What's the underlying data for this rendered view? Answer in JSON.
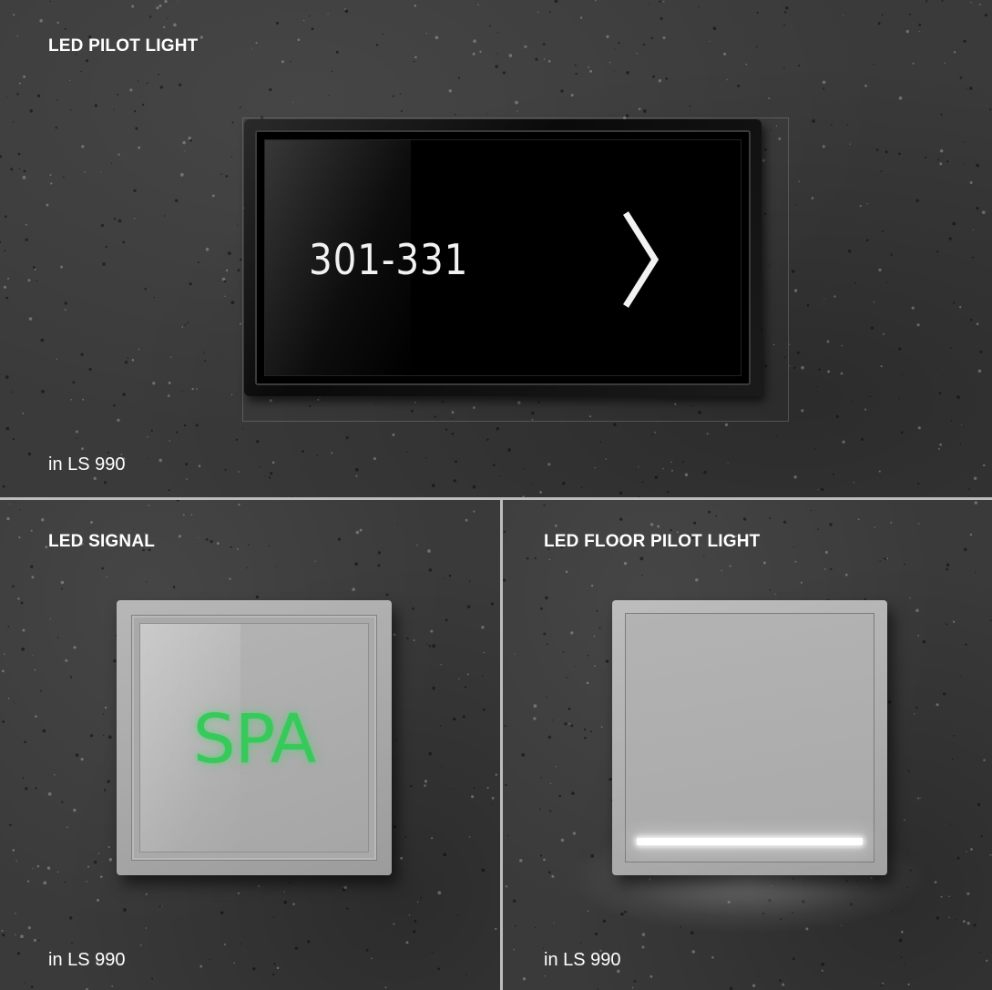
{
  "panels": {
    "pilot_light": {
      "title": "LED PILOT LIGHT",
      "display_number": "301-331",
      "arrow_icon": "chevron-right-icon",
      "caption": "in LS 990"
    },
    "signal": {
      "title": "LED SIGNAL",
      "display_text": "SPA",
      "caption": "in LS 990"
    },
    "floor_pilot_light": {
      "title": "LED FLOOR PILOT LIGHT",
      "caption": "in LS 990"
    }
  },
  "colors": {
    "concrete": "#3a3a3a",
    "signal_green": "#37c95a",
    "switch_grey": "#a9a9a9",
    "display_black": "#000000"
  }
}
